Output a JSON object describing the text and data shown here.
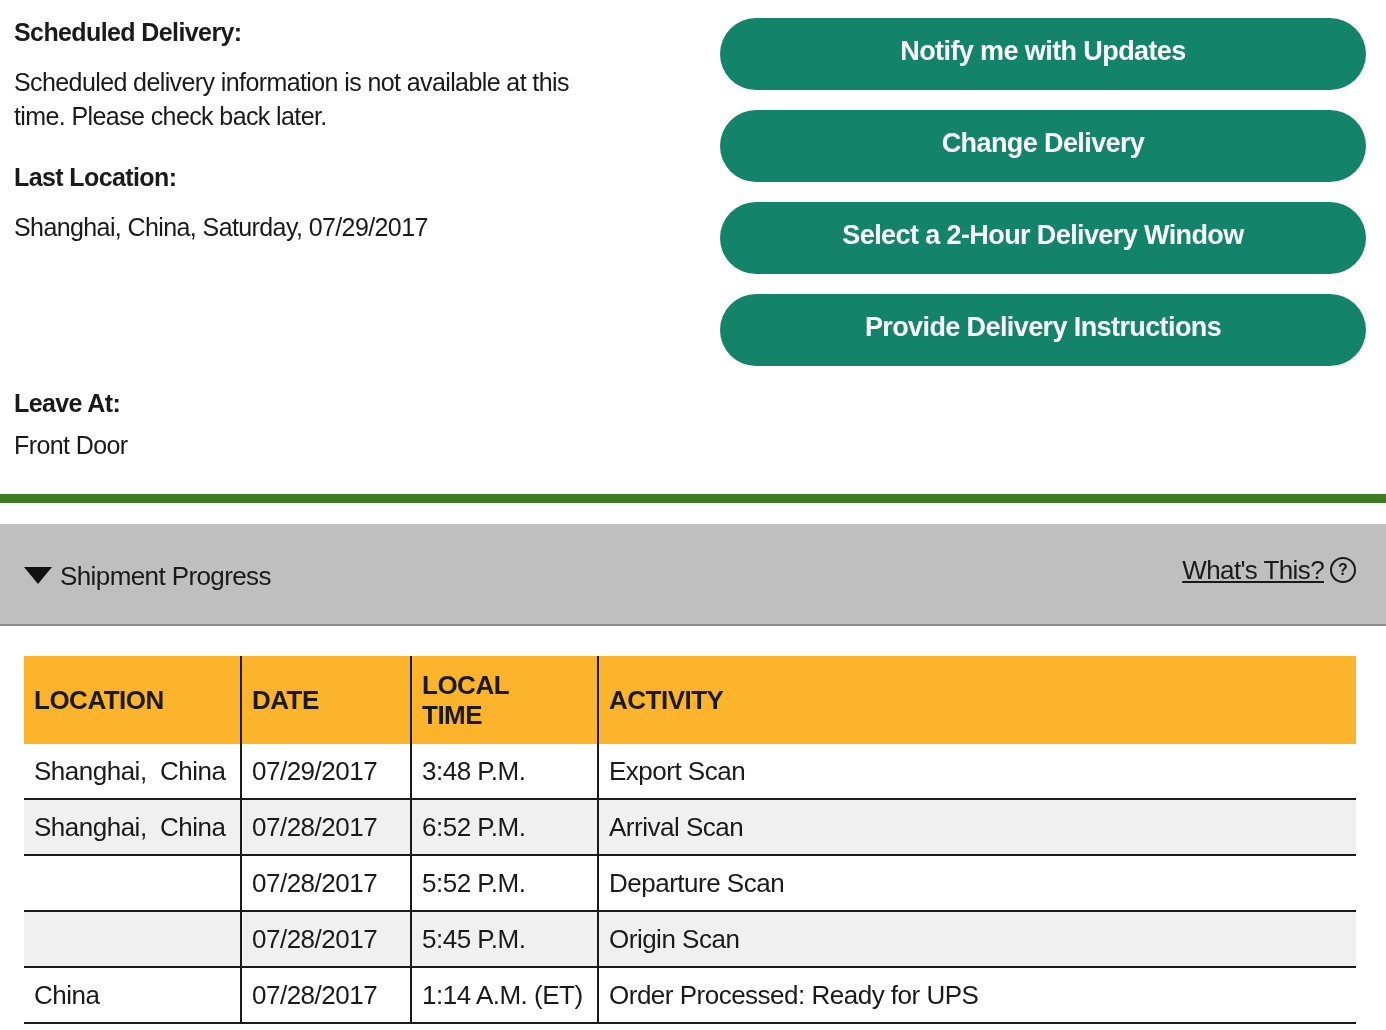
{
  "delivery_info": [
    {
      "label": "Scheduled Delivery:",
      "text": "Scheduled delivery information is not available at this time. Please check back later."
    },
    {
      "label": "Last Location:",
      "text": "Shanghai, China, Saturday, 07/29/2017"
    },
    {
      "label": "Leave At:",
      "text": "Front Door"
    }
  ],
  "actions": [
    "Notify me with Updates",
    "Change Delivery",
    "Select a 2-Hour Delivery Window",
    "Provide Delivery Instructions"
  ],
  "progress": {
    "title": "Shipment Progress",
    "expanded": true,
    "help_link": "What's This?",
    "help_glyph": "?"
  },
  "table": {
    "columns": [
      "LOCATION",
      "DATE",
      "LOCAL TIME",
      "ACTIVITY"
    ],
    "rows": [
      [
        "Shanghai,  China",
        "07/29/2017",
        "3:48 P.M.",
        "Export Scan"
      ],
      [
        "Shanghai,  China",
        "07/28/2017",
        "6:52 P.M.",
        "Arrival Scan"
      ],
      [
        "",
        "07/28/2017",
        "5:52 P.M.",
        "Departure Scan"
      ],
      [
        "",
        "07/28/2017",
        "5:45 P.M.",
        "Origin Scan"
      ],
      [
        "China",
        "07/28/2017",
        "1:14 A.M. (ET)",
        "Order Processed: Ready for UPS"
      ]
    ]
  }
}
